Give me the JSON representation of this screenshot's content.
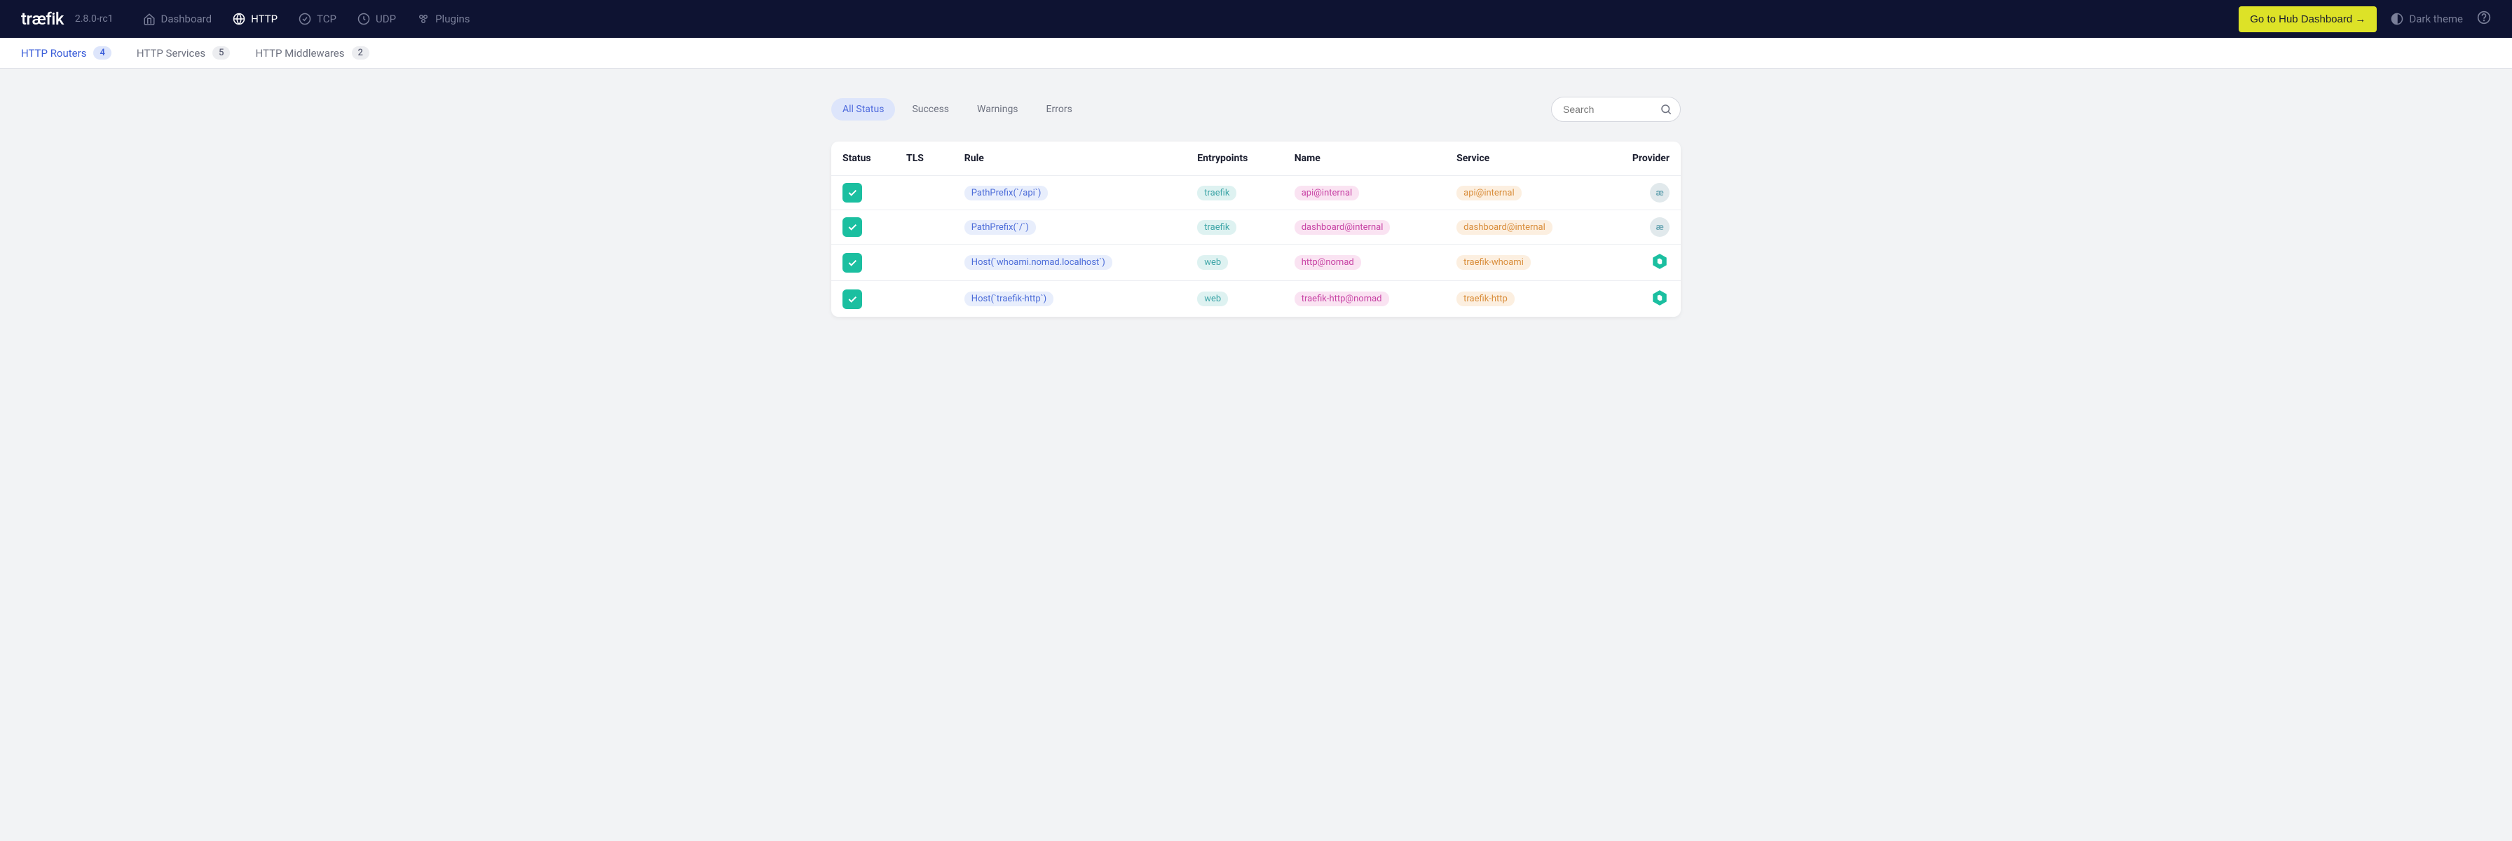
{
  "brand": "træfik",
  "version": "2.8.0-rc1",
  "nav": [
    {
      "label": "Dashboard",
      "icon": "home"
    },
    {
      "label": "HTTP",
      "icon": "globe",
      "active": true
    },
    {
      "label": "TCP",
      "icon": "tcp"
    },
    {
      "label": "UDP",
      "icon": "udp"
    },
    {
      "label": "Plugins",
      "icon": "plugins"
    }
  ],
  "hub_button": "Go to Hub Dashboard →",
  "theme_label": "Dark theme",
  "subnav": [
    {
      "label": "HTTP Routers",
      "count": "4",
      "active": true
    },
    {
      "label": "HTTP Services",
      "count": "5"
    },
    {
      "label": "HTTP Middlewares",
      "count": "2"
    }
  ],
  "filters": [
    {
      "label": "All Status",
      "active": true
    },
    {
      "label": "Success"
    },
    {
      "label": "Warnings"
    },
    {
      "label": "Errors"
    }
  ],
  "search_placeholder": "Search",
  "columns": {
    "status": "Status",
    "tls": "TLS",
    "rule": "Rule",
    "entrypoints": "Entrypoints",
    "name": "Name",
    "service": "Service",
    "provider": "Provider"
  },
  "rows": [
    {
      "rule": "PathPrefix(`/api`)",
      "entrypoint": "traefik",
      "name": "api@internal",
      "service": "api@internal",
      "provider": "internal"
    },
    {
      "rule": "PathPrefix(`/`)",
      "entrypoint": "traefik",
      "name": "dashboard@internal",
      "service": "dashboard@internal",
      "provider": "internal"
    },
    {
      "rule": "Host(`whoami.nomad.localhost`)",
      "entrypoint": "web",
      "name": "http@nomad",
      "service": "traefik-whoami",
      "provider": "nomad"
    },
    {
      "rule": "Host(`traefik-http`)",
      "entrypoint": "web",
      "name": "traefik-http@nomad",
      "service": "traefik-http",
      "provider": "nomad"
    }
  ]
}
